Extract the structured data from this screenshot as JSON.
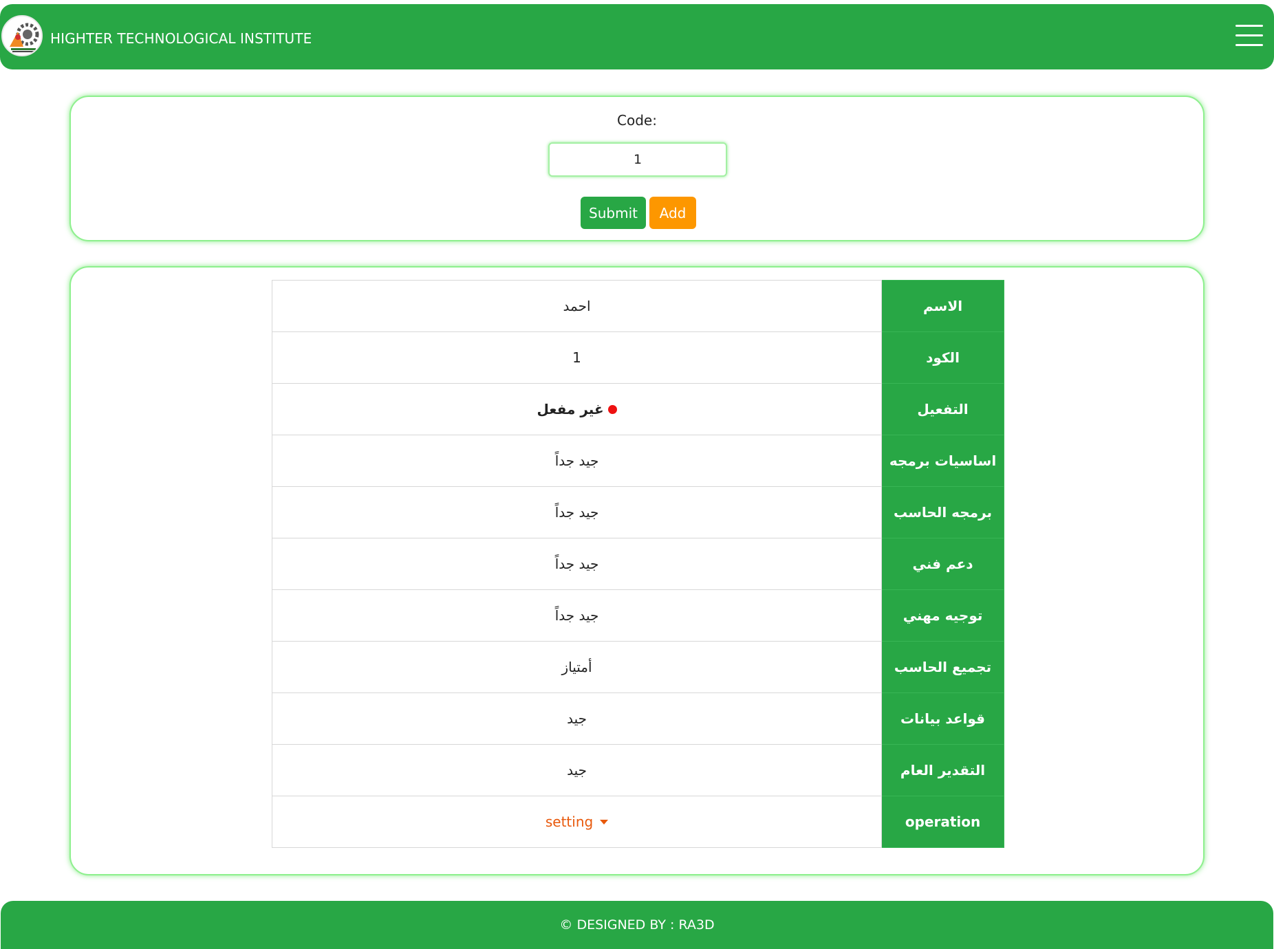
{
  "header": {
    "brand": "HIGHTER TECHNOLOGICAL INSTITUTE",
    "logo_icon": "institute-logo-icon",
    "menu_icon": "hamburger-menu-icon"
  },
  "search": {
    "label": "Code:",
    "input_value": "1",
    "submit_label": "Submit",
    "add_label": "Add"
  },
  "table": {
    "rows": [
      {
        "key": "الاسم",
        "value": "احمد"
      },
      {
        "key": "الكود",
        "value": "1"
      },
      {
        "key": "التفعيل",
        "value": "غير مفعل",
        "status_color": "#ee1111"
      },
      {
        "key": "اساسيات برمجه",
        "value": "جيد جداً"
      },
      {
        "key": "برمجه الحاسب",
        "value": "جيد جداً"
      },
      {
        "key": "دعم فني",
        "value": "جيد جداً"
      },
      {
        "key": "توجيه مهني",
        "value": "جيد جداً"
      },
      {
        "key": "تجميع الحاسب",
        "value": "أمتياز"
      },
      {
        "key": "قواعد بيانات",
        "value": "جيد"
      },
      {
        "key": "التقدير العام",
        "value": "جيد"
      },
      {
        "key": "operation",
        "value": "setting"
      }
    ]
  },
  "footer": {
    "text": "© DESIGNED BY : RA3D"
  },
  "colors": {
    "primary_green": "#28a745",
    "accent_orange": "#fd9700",
    "setting_orange": "#e8590c",
    "status_red": "#ee1111"
  }
}
